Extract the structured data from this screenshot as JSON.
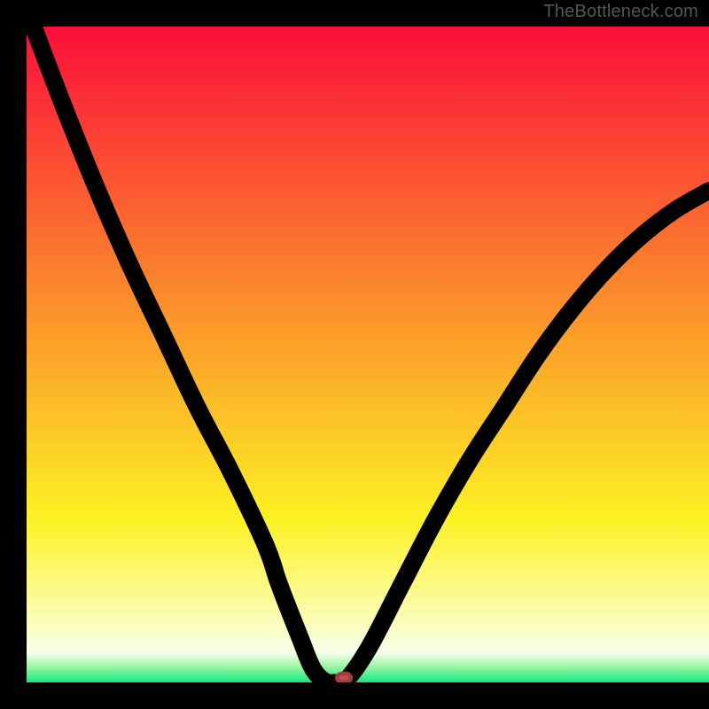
{
  "watermark": "TheBottleneck.com",
  "chart_data": {
    "type": "line",
    "title": "",
    "xlabel": "",
    "ylabel": "",
    "xlim": [
      0,
      100
    ],
    "ylim": [
      0,
      100
    ],
    "grid": false,
    "legend": false,
    "series": [
      {
        "name": "bottleneck-curve",
        "x": [
          1,
          5,
          10,
          15,
          20,
          25,
          30,
          35,
          37,
          40,
          42,
          44,
          45,
          46.5,
          50,
          55,
          60,
          65,
          70,
          75,
          80,
          85,
          90,
          95,
          100
        ],
        "y": [
          100,
          89,
          76,
          64,
          53,
          42,
          32,
          21,
          15,
          7,
          2,
          0,
          0,
          0,
          5,
          15,
          25,
          34,
          42,
          50,
          57,
          63,
          68,
          72,
          75
        ]
      }
    ],
    "marker": {
      "name": "current-point",
      "x": 46.5,
      "y": 0.7,
      "color": "#c0504e"
    },
    "background_gradient": {
      "stops": [
        {
          "offset": 0,
          "color": "#fb0e3b"
        },
        {
          "offset": 0.48,
          "color": "#fba028"
        },
        {
          "offset": 0.75,
          "color": "#fcf123"
        },
        {
          "offset": 0.9,
          "color": "#fbfdb0"
        },
        {
          "offset": 0.955,
          "color": "#f7feea"
        },
        {
          "offset": 0.975,
          "color": "#a0f5a8"
        },
        {
          "offset": 1.0,
          "color": "#13e87e"
        }
      ]
    }
  }
}
